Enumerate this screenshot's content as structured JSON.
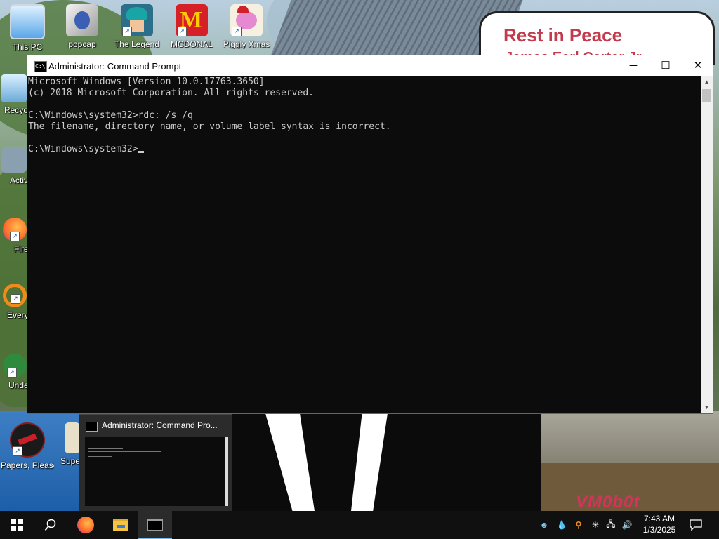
{
  "wallpaper": {
    "sign_title": "Rest in Peace",
    "sign_subtitle": "James Earl Carter Jr.",
    "watermark": "VM0b0t"
  },
  "desktop_icons": [
    {
      "label": "This PC",
      "icon": "computer-icon"
    },
    {
      "label": "popcap",
      "icon": "folder-icon"
    },
    {
      "label": "The Legend",
      "icon": "game-icon"
    },
    {
      "label": "MCDONAL",
      "icon": "mcdonalds-icon"
    },
    {
      "label": "Piggly Xmas",
      "icon": "pig-icon"
    },
    {
      "label": "Recyc",
      "icon": "recycle-bin-icon"
    },
    {
      "label": "Activ",
      "icon": "app-icon"
    },
    {
      "label": "Fire",
      "icon": "firefox-icon"
    },
    {
      "label": "Every",
      "icon": "search-app-icon"
    },
    {
      "label": "Unde",
      "icon": "game-icon"
    },
    {
      "label": "Papers, Please",
      "icon": "papers-please-icon"
    },
    {
      "label": "Super",
      "icon": "game-icon"
    }
  ],
  "cmd_window": {
    "title": "Administrator: Command Prompt",
    "lines": [
      "Microsoft Windows [Version 10.0.17763.3650]",
      "(c) 2018 Microsoft Corporation. All rights reserved.",
      "",
      "C:\\Windows\\system32>rdc: /s /q",
      "The filename, directory name, or volume label syntax is incorrect.",
      ""
    ],
    "prompt": "C:\\Windows\\system32>",
    "minimize_symbol": "─",
    "maximize_symbol": "☐",
    "close_symbol": "✕"
  },
  "preview": {
    "title": "Administrator: Command Pro..."
  },
  "taskbar": {
    "start_icon": "windows-logo-icon",
    "search_icon": "search-icon",
    "apps": [
      "firefox-icon",
      "file-explorer-icon",
      "command-prompt-icon"
    ],
    "tray_icons": [
      "people-icon",
      "water-drop-icon",
      "search-tool-icon",
      "snowflake-icon",
      "network-icon",
      "volume-icon"
    ],
    "time": "7:43 AM",
    "date": "1/3/2025",
    "notification_icon": "notification-icon"
  }
}
